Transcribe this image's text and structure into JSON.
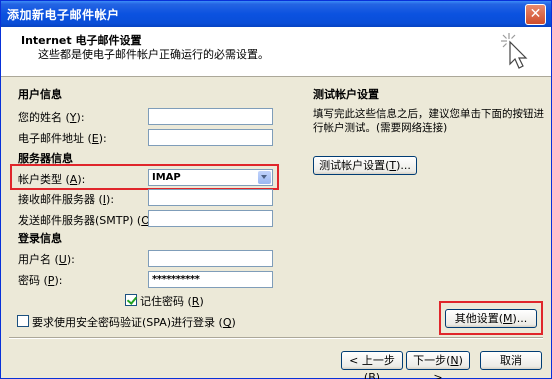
{
  "window": {
    "title": "添加新电子邮件帐户"
  },
  "header": {
    "title": "Internet 电子邮件设置",
    "subtitle": "这些都是使电子邮件帐户正确运行的必需设置。"
  },
  "user_info": {
    "heading": "用户信息",
    "name_label": "您的姓名",
    "name_key": "Y",
    "email_label": "电子邮件地址",
    "email_key": "E",
    "name_value": "",
    "email_value": ""
  },
  "server_info": {
    "heading": "服务器信息",
    "account_type_label": "帐户类型",
    "account_type_key": "A",
    "account_type_value": "IMAP",
    "incoming_label": "接收邮件服务器",
    "incoming_key": "I",
    "outgoing_label": "发送邮件服务器(SMTP)",
    "outgoing_key": "O",
    "incoming_value": "",
    "outgoing_value": ""
  },
  "login_info": {
    "heading": "登录信息",
    "username_label": "用户名",
    "username_key": "U",
    "password_label": "密码",
    "password_key": "P",
    "username_value": "",
    "password_value": "**********",
    "remember_label": "记住密码",
    "remember_key": "R",
    "remember_checked": true,
    "spa_label": "要求使用安全密码验证(SPA)进行登录",
    "spa_key": "Q",
    "spa_checked": false
  },
  "test_settings": {
    "heading": "测试帐户设置",
    "description_line1": "填写完此这些信息之后，建议您单击下面的按钮进",
    "description_line2": "行帐户测试。(需要网络连接)",
    "test_button": "测试帐户设置",
    "test_key": "T"
  },
  "buttons": {
    "more_settings": "其他设置",
    "more_settings_key": "M",
    "back": "上一步",
    "back_key": "B",
    "next": "下一步",
    "next_key": "N",
    "cancel": "取消"
  },
  "colors": {
    "titlebar": "#0b52e0",
    "dialog_bg": "#ece9d8",
    "highlight_red": "#e0262b"
  }
}
